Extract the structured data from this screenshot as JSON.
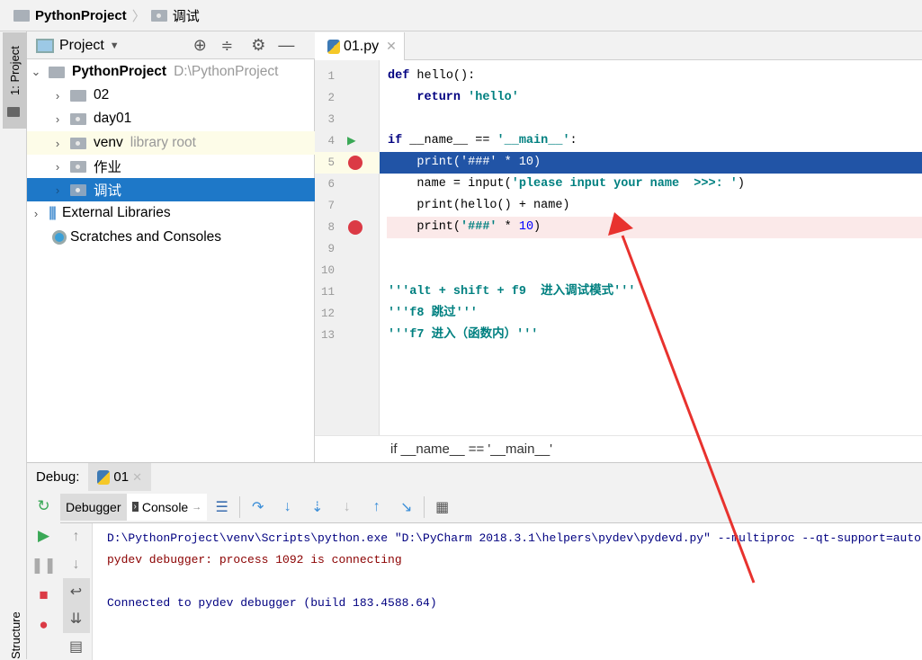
{
  "breadcrumb": {
    "project": "PythonProject",
    "folder": "调试"
  },
  "left_strip": {
    "project_tab": "1: Project",
    "structure_tab": "Structure"
  },
  "project_panel": {
    "title": "Project",
    "tree": [
      {
        "name": "PythonProject",
        "hint": "D:\\PythonProject",
        "expanded": true
      },
      {
        "name": "02"
      },
      {
        "name": "day01"
      },
      {
        "name": "venv",
        "hint": "library root"
      },
      {
        "name": "作业"
      },
      {
        "name": "调试",
        "selected": true
      },
      {
        "name": "External Libraries"
      },
      {
        "name": "Scratches and Consoles"
      }
    ]
  },
  "editor": {
    "tab": "01.py",
    "line_numbers": [
      "1",
      "2",
      "3",
      "4",
      "5",
      "6",
      "7",
      "8",
      "9",
      "10",
      "11",
      "12",
      "13"
    ],
    "code": {
      "l1a": "def",
      "l1b": " hello():",
      "l2a": "return",
      "l2b": "'hello'",
      "l4a": "if",
      "l4b": " __name__ == ",
      "l4c": "'__main__'",
      "l4d": ":",
      "l5": "print('###' * 10)",
      "l6a": "name = input(",
      "l6b": "'please input your name  >>>: '",
      "l6c": ")",
      "l7": "print(hello() + name)",
      "l8a": "print(",
      "l8b": "'###'",
      "l8c": " * ",
      "l8d": "10",
      "l8e": ")",
      "l11": "'''alt + shift + f9  进入调试模式'''",
      "l12": "'''f8 跳过'''",
      "l13": "'''f7 进入（函数内）'''"
    },
    "breakpoint_lines": [
      5,
      8
    ],
    "current_line": 5,
    "status_breadcrumb": "if __name__ == '__main__'"
  },
  "debug": {
    "label": "Debug:",
    "session_tab": "01",
    "tabs": [
      "Debugger",
      "Console"
    ],
    "console_lines": [
      "D:\\PythonProject\\venv\\Scripts\\python.exe \"D:\\PyCharm 2018.3.1\\helpers\\pydev\\pydevd.py\" --multiproc --qt-support=auto",
      "pydev debugger: process 1092 is connecting",
      "Connected to pydev debugger (build 183.4588.64)"
    ]
  },
  "colors": {
    "selection": "#1e78c8",
    "current_line": "#2154a6",
    "breakpoint_line": "#fbe9e9",
    "breakpoint": "#db3a45",
    "arrow": "#e8322e"
  }
}
